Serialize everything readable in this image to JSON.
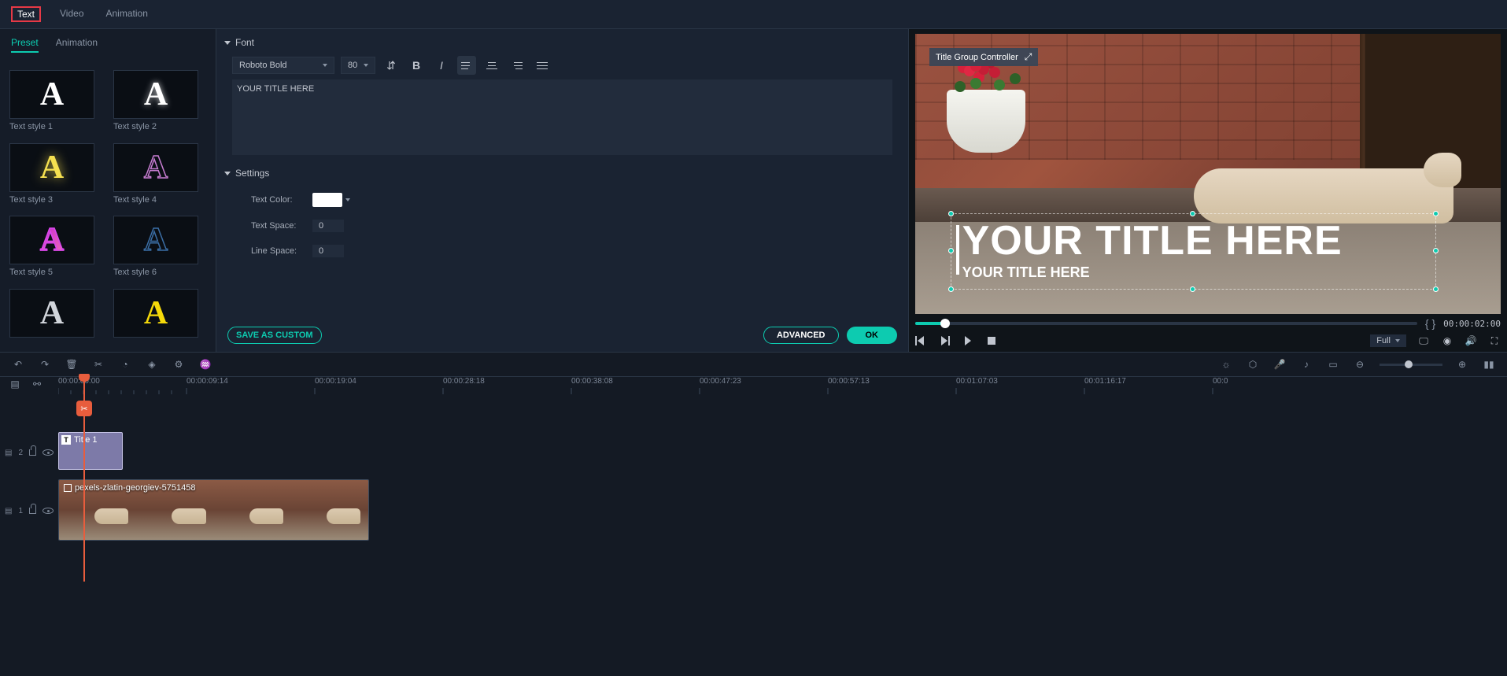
{
  "topTabs": {
    "text": "Text",
    "video": "Video",
    "animation": "Animation"
  },
  "subTabs": {
    "preset": "Preset",
    "animation": "Animation"
  },
  "presets": {
    "s1": "Text style 1",
    "s2": "Text style 2",
    "s3": "Text style 3",
    "s4": "Text style 4",
    "s5": "Text style 5",
    "s6": "Text style 6"
  },
  "inspector": {
    "fontSection": "Font",
    "fontFamily": "Roboto Bold",
    "fontSize": "80",
    "textValue": "YOUR TITLE HERE",
    "settingsSection": "Settings",
    "textColorLabel": "Text Color:",
    "textColorValue": "#ffffff",
    "textSpaceLabel": "Text Space:",
    "textSpaceValue": "0",
    "lineSpaceLabel": "Line Space:",
    "lineSpaceValue": "0",
    "saveCustom": "SAVE AS CUSTOM",
    "advanced": "ADVANCED",
    "ok": "OK"
  },
  "preview": {
    "controllerLabel": "Title Group Controller",
    "titleMain": "YOUR TITLE HERE",
    "titleSub": "YOUR TITLE HERE",
    "timecode": "00:00:02:00",
    "quality": "Full"
  },
  "timeline": {
    "marks": [
      "00:00:00:00",
      "00:00:09:14",
      "00:00:19:04",
      "00:00:28:18",
      "00:00:38:08",
      "00:00:47:23",
      "00:00:57:13",
      "00:01:07:03",
      "00:01:16:17"
    ],
    "endMark": "00:0",
    "titleTrackNum": "2",
    "videoTrackNum": "1",
    "titleClip": "Title 1",
    "videoClip": "pexels-zlatin-georgiev-5751458"
  }
}
